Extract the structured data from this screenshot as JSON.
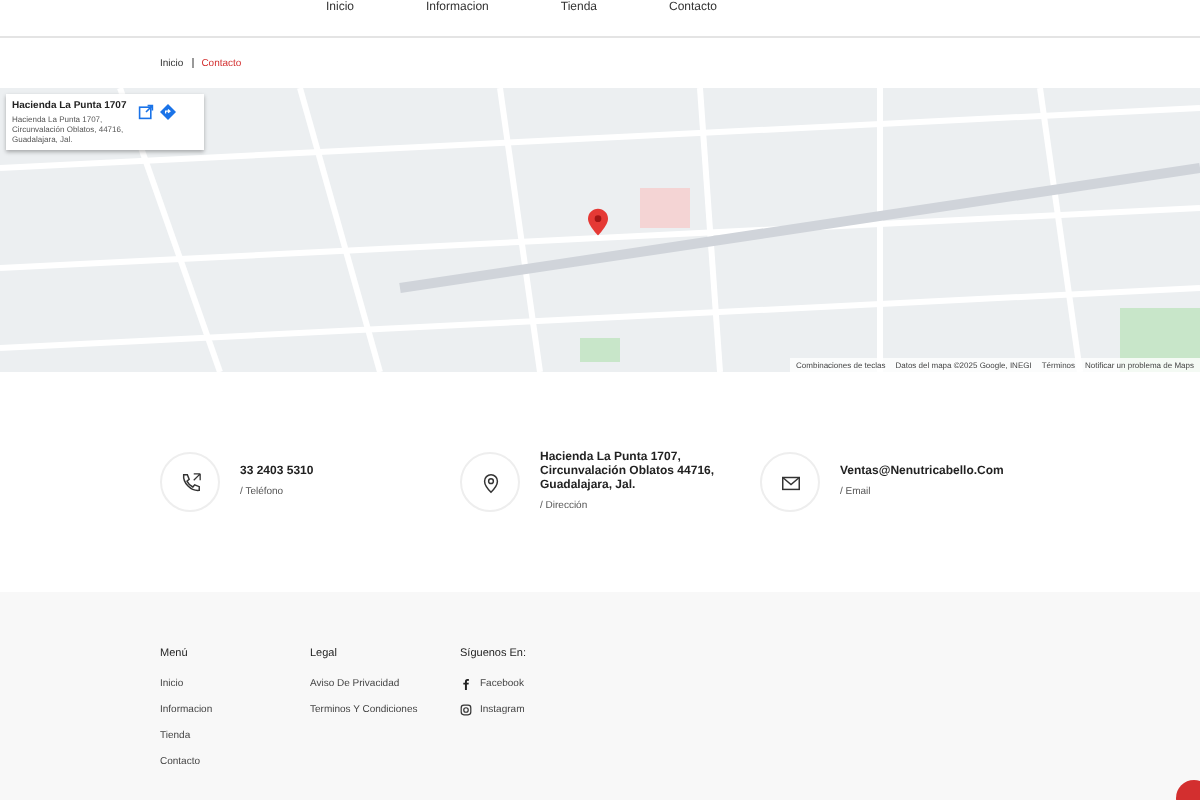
{
  "nav": [
    {
      "label": "Inicio",
      "selected": false
    },
    {
      "label": "Informacion",
      "selected": false
    },
    {
      "label": "Tienda",
      "selected": false
    },
    {
      "label": "Contacto",
      "selected": false
    }
  ],
  "breadcrumb": [
    {
      "label": "Inicio",
      "selected": false
    },
    {
      "label": "Contacto",
      "selected": true
    }
  ],
  "map": {
    "card": {
      "title": "Hacienda La Punta 1707",
      "address": "Hacienda La Punta 1707, Circunvalación Oblatos, 44716, Guadalajara, Jal."
    },
    "footer_links": [
      "Combinaciones de teclas",
      "Datos del mapa ©2025 Google, INEGI",
      "Términos",
      "Notificar un problema de Maps"
    ]
  },
  "contacts": [
    {
      "kind": "phone",
      "value": "33 2403 5310",
      "label": "/ Teléfono"
    },
    {
      "kind": "location",
      "value": "Hacienda La Punta 1707, Circunvalación Oblatos 44716, Guadalajara, Jal.",
      "label": "/ Dirección"
    },
    {
      "kind": "email",
      "value": "Ventas@Nenutricabello.Com",
      "label": "/ Email"
    }
  ],
  "footer": {
    "columns": [
      {
        "title": "Menú",
        "links": [
          {
            "label": "Inicio"
          },
          {
            "label": "Informacion"
          },
          {
            "label": "Tienda"
          },
          {
            "label": "Contacto"
          }
        ]
      },
      {
        "title": "Legal",
        "links": [
          {
            "label": "Aviso De Privacidad"
          },
          {
            "label": "Terminos Y Condiciones"
          }
        ]
      },
      {
        "title": "Síguenos En:",
        "links": [
          {
            "label": "Facebook",
            "kind": "facebook"
          },
          {
            "label": "Instagram",
            "kind": "instagram"
          }
        ]
      }
    ]
  }
}
